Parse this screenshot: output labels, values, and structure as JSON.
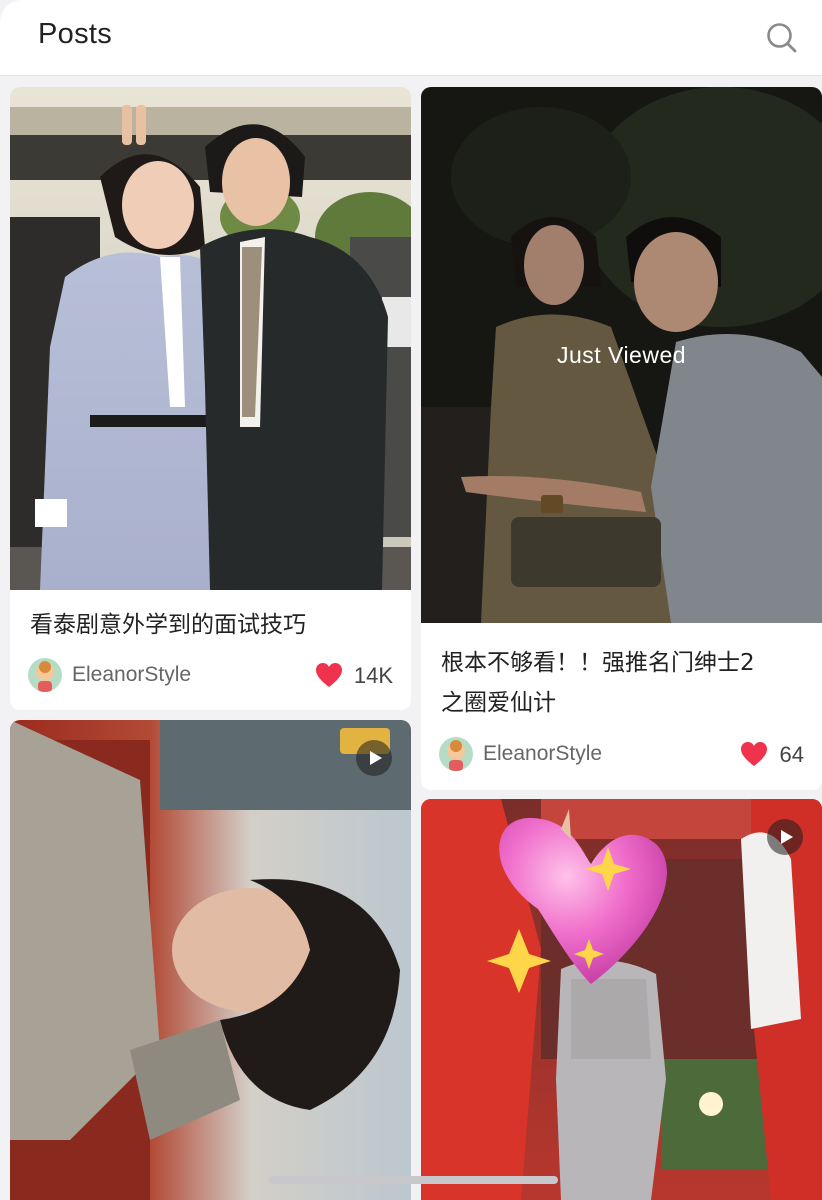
{
  "header": {
    "title": "Posts"
  },
  "icons": {
    "search": "search-icon",
    "heart": "heart-icon",
    "play": "play-icon",
    "avatar": "avatar-cartoon"
  },
  "colors": {
    "heart": "#f0334d",
    "background": "#f2f2f4"
  },
  "posts": [
    {
      "title_lines": [
        "看泰剧意外学到的面试技巧"
      ],
      "author": "EleanorStyle",
      "likes": "14K",
      "photo_desc": "A smiling woman in a lilac dress and a man in a dark suit pose together outdoors"
    },
    {
      "title_lines": [
        "根本不够看！！强推名门绅士2",
        "之圈爱仙计"
      ],
      "author": "EleanorStyle",
      "likes": "64",
      "overlay": "Just Viewed",
      "photo_desc": "A man and a woman pose playfully at night in front of trees"
    },
    {
      "is_video": true,
      "photo_desc": "A young man with dark hair lying down, smiling, on a red cushion"
    },
    {
      "is_video": true,
      "photo_desc": "A performer in a sparkly outfit on a stage with red decorations, face covered by a pink heart sticker"
    }
  ]
}
